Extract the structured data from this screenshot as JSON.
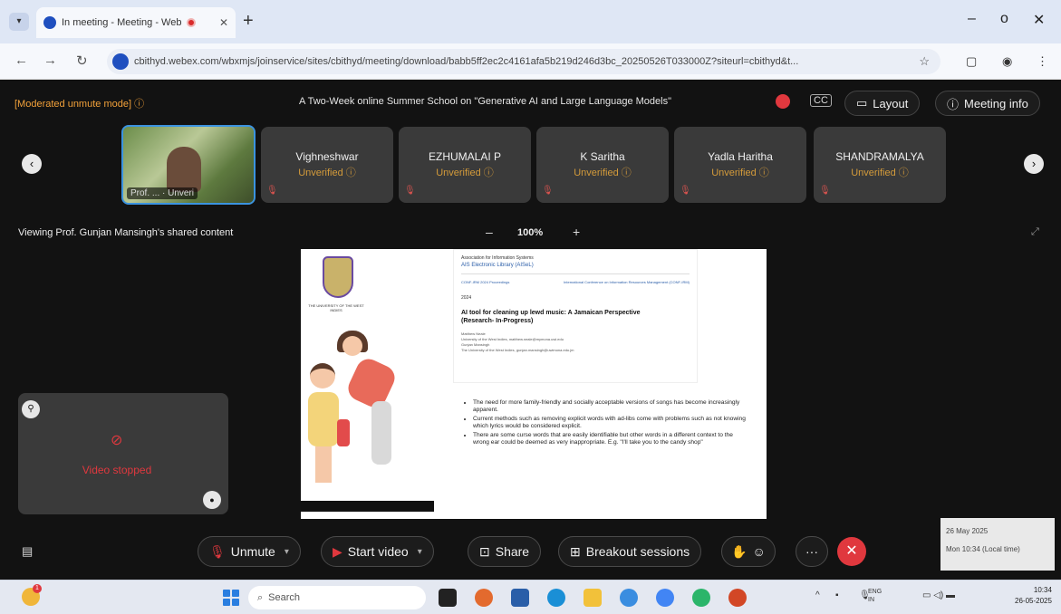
{
  "browser": {
    "tab_title": "In meeting - Meeting - Web",
    "tab_close": "✕",
    "new_tab": "+",
    "url": "cbithyd.webex.com/wbxmjs/joinservice/sites/cbithyd/meeting/download/babb5ff2ec2c4161afa5b219d246d3bc_20250526T033000Z?siteurl=cbithyd&t...",
    "minimize": "–",
    "maximize": "o",
    "close": "✕"
  },
  "meeting": {
    "mode_label": "[Moderated unmute mode] ⓘ",
    "title": "A Two-Week online Summer School on \"Generative AI and Large Language Models\"",
    "layout_label": "Layout",
    "meeting_info_label": "Meeting info",
    "cc_label": "CC"
  },
  "participants": {
    "self": {
      "label": "Prof. ... · Unveri"
    },
    "tiles": [
      {
        "name": "Vighneshwar",
        "status": "Unverified ⓘ"
      },
      {
        "name": "EZHUMALAI P",
        "status": "Unverified ⓘ"
      },
      {
        "name": "K Saritha",
        "status": "Unverified ⓘ"
      },
      {
        "name": "Yadla Haritha",
        "status": "Unverified ⓘ"
      },
      {
        "name": "SHANDRAMALYA",
        "status": "Unverified ⓘ"
      }
    ]
  },
  "viewer": {
    "viewing_text": "Viewing Prof. Gunjan Mansingh's shared content",
    "zoom_minus": "–",
    "zoom_value": "100%",
    "zoom_plus": "+"
  },
  "slide": {
    "university": "THE UNIVERSITY OF THE WEST INDIES",
    "assoc": "Association for Information Systems",
    "library": "AIS Electronic Library (AISeL)",
    "left_ref": "CONF-IRM 2024 Proceedings",
    "right_ref": "International Conference on Information Resources Management (CONF-IRM)",
    "year": "2024",
    "paper_title": "AI tool for cleaning up lewd music: A Jamaican Perspective",
    "paper_subtitle": "(Research- In-Progress)",
    "author1": "Matthew Neale",
    "author1_aff": "University of the West Indies, matthew.neale@mymona.uwi.edu",
    "author2": "Gunjan Mansingh",
    "author2_aff": "The University of the West Indies, gunjan.mansingh@uwimona.edu.jm",
    "bullets": [
      "The need for more family-friendly and socially acceptable versions of songs has become increasingly apparent.",
      "Current methods such as removing explicit words with ad-libs come with problems such as not knowing which lyrics would be considered explicit.",
      "There are some curse words that are easily identifiable but other words in a different context to the wrong ear could be deemed as very inappropriate. E.g. \"I'll take you to the candy shop\""
    ]
  },
  "self_video": {
    "status": "Video stopped"
  },
  "controls": {
    "unmute": "Unmute",
    "start_video": "Start video",
    "share": "Share",
    "breakout": "Breakout sessions",
    "more": "···",
    "end": "✕"
  },
  "datetime_overlay": {
    "date": "26 May 2025",
    "time": "Mon 10:34 (Local time)"
  },
  "taskbar": {
    "search_placeholder": "Search",
    "lang": "ENG IN",
    "time": "10:34",
    "date": "26-05-2025",
    "weather_badge": "1"
  }
}
